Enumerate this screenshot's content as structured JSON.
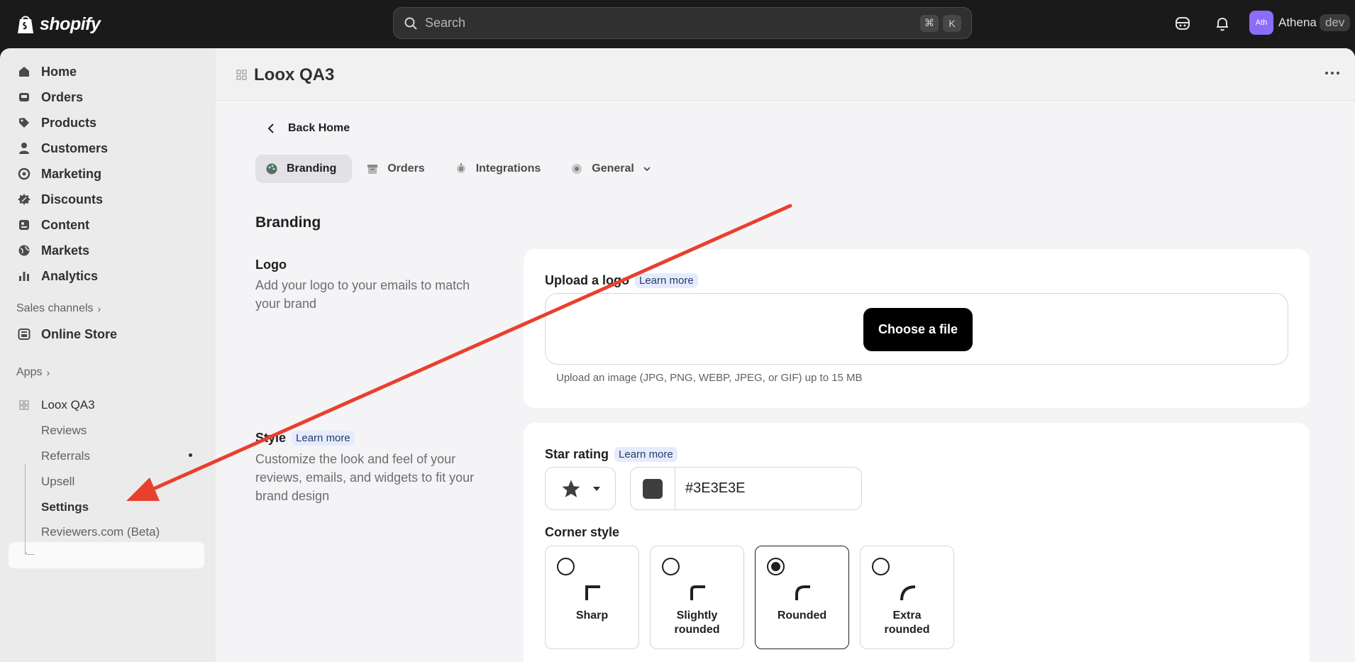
{
  "topbar": {
    "brand": "shopify",
    "search_placeholder": "Search",
    "shortcut_keys": [
      "⌘",
      "K"
    ],
    "avatar_initials": "Ath",
    "user_name": "Athena",
    "store_badge": "dev"
  },
  "sidebar": {
    "items": [
      {
        "label": "Home",
        "icon": "home-icon"
      },
      {
        "label": "Orders",
        "icon": "inbox-icon"
      },
      {
        "label": "Products",
        "icon": "tag-icon"
      },
      {
        "label": "Customers",
        "icon": "person-icon"
      },
      {
        "label": "Marketing",
        "icon": "target-icon"
      },
      {
        "label": "Discounts",
        "icon": "discount-icon"
      },
      {
        "label": "Content",
        "icon": "image-icon"
      },
      {
        "label": "Markets",
        "icon": "globe-icon"
      },
      {
        "label": "Analytics",
        "icon": "bar-chart-icon"
      }
    ],
    "sales_channels_label": "Sales channels",
    "online_store_label": "Online Store",
    "apps_label": "Apps",
    "app_name": "Loox QA3",
    "app_sub_items": [
      "Reviews",
      "Referrals",
      "Upsell",
      "Settings",
      "Reviewers.com (Beta)"
    ],
    "active_sub_item": "Settings"
  },
  "page": {
    "title": "Loox QA3",
    "back_label": "Back Home",
    "tabs": [
      {
        "label": "Branding",
        "active": true
      },
      {
        "label": "Orders",
        "active": false
      },
      {
        "label": "Integrations",
        "active": false
      },
      {
        "label": "General",
        "active": false
      }
    ],
    "heading": "Branding",
    "logo_section": {
      "title": "Logo",
      "description": "Add your logo to your emails to match your brand",
      "card_label": "Upload a logo",
      "learn_more": "Learn more",
      "button": "Choose a file",
      "hint": "Upload an image (JPG, PNG, WEBP, JPEG, or GIF) up to 15 MB"
    },
    "style_section": {
      "title": "Style",
      "learn_more": "Learn more",
      "description": "Customize the look and feel of your reviews, emails, and widgets to fit your brand design",
      "star_rating_label": "Star rating",
      "star_learn_more": "Learn more",
      "star_color": "#3E3E3E",
      "corner_style_label": "Corner style",
      "corner_options": [
        {
          "label": "Sharp",
          "selected": false
        },
        {
          "label": "Slightly rounded",
          "selected": false
        },
        {
          "label": "Rounded",
          "selected": true
        },
        {
          "label": "Extra rounded",
          "selected": false
        }
      ]
    }
  },
  "colors": {
    "annotation_arrow": "#e8402e",
    "swatch": "#3e3e3e"
  }
}
